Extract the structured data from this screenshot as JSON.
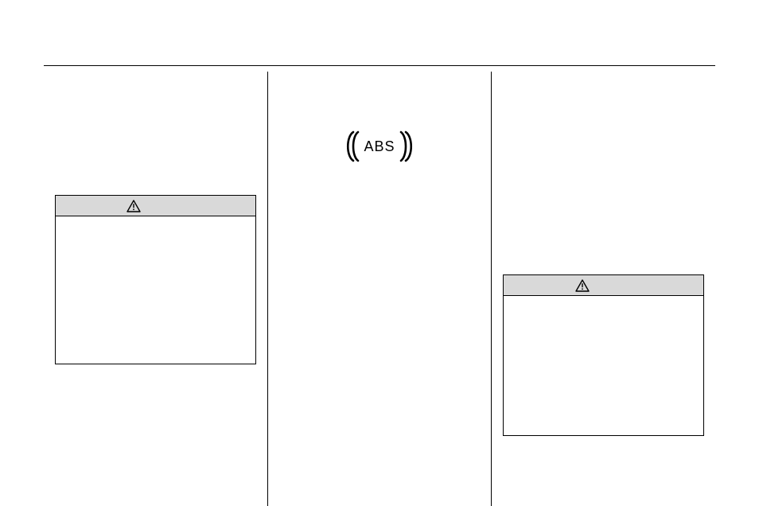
{
  "header": {
    "page_number": "",
    "section_title": ""
  },
  "columns": {
    "col1": {
      "intro_text": "",
      "caution": {
        "label": "CAUTION",
        "body": ""
      },
      "after_text": ""
    },
    "col2": {
      "heading": "",
      "abs_icon_label": "ABS",
      "body_text": ""
    },
    "col3": {
      "intro_text": "",
      "caution": {
        "label": "CAUTION",
        "body": ""
      }
    }
  },
  "icons": {
    "warning": "warning-triangle",
    "abs": "abs-brackets"
  }
}
